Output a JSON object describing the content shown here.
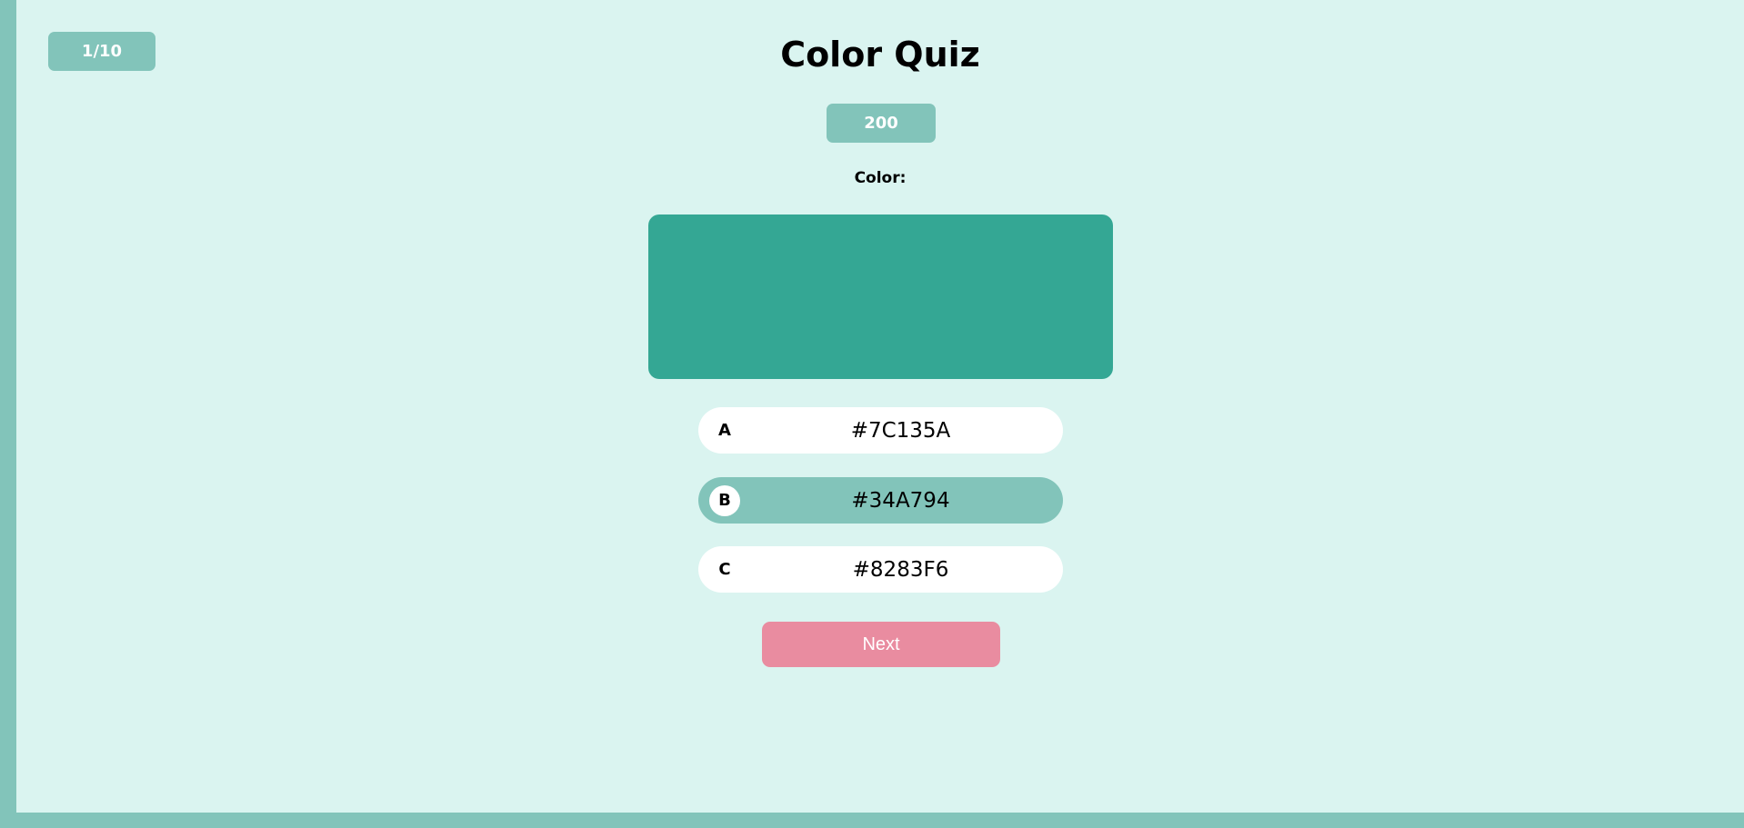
{
  "quiz": {
    "progress": "1/10",
    "title": "Color Quiz",
    "score": "200",
    "color_label": "Color:",
    "swatch_color": "#34A794",
    "options": [
      {
        "letter": "A",
        "value": "#7C135A",
        "selected": false
      },
      {
        "letter": "B",
        "value": "#34A794",
        "selected": true
      },
      {
        "letter": "C",
        "value": "#8283F6",
        "selected": false
      }
    ],
    "next_label": "Next"
  },
  "colors": {
    "accent": "#82C4BA",
    "background": "#DAF4F0",
    "next_button": "#E98CA0"
  }
}
